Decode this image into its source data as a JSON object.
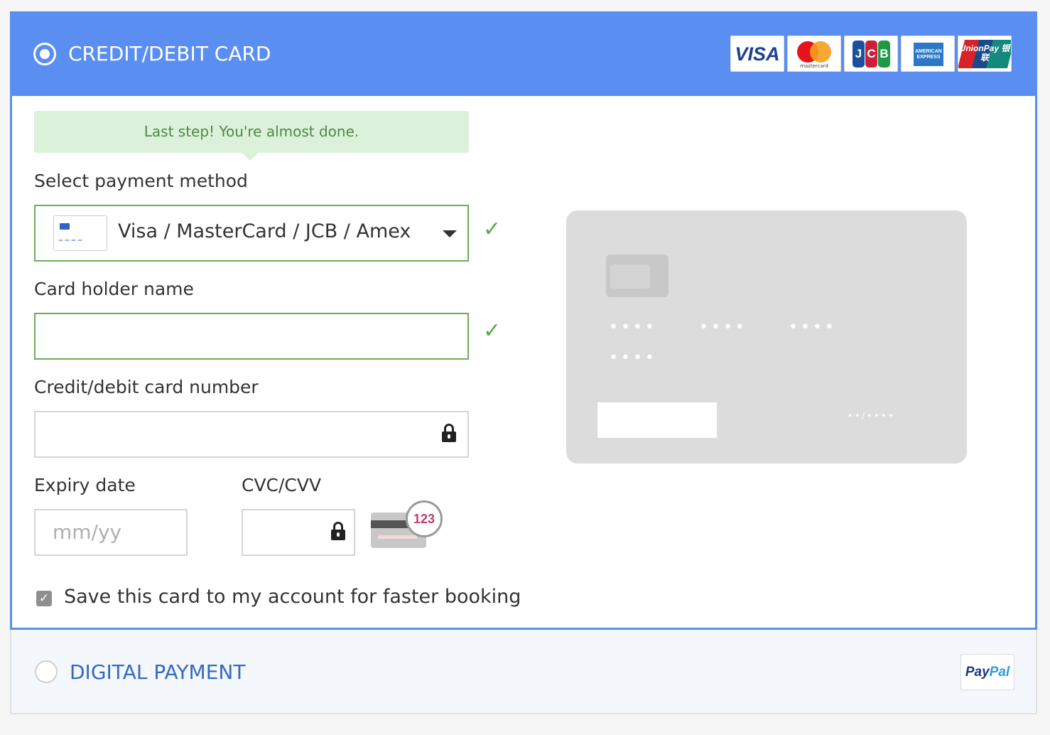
{
  "credit_section": {
    "title": "CREDIT/DEBIT CARD",
    "brands": [
      "VISA",
      "mastercard",
      "JCB",
      "AMERICAN EXPRESS",
      "UnionPay 银联"
    ]
  },
  "notice": "Last step! You're almost done.",
  "payment_method": {
    "label": "Select payment method",
    "selected": "Visa / MasterCard / JCB / Amex"
  },
  "card_holder": {
    "label": "Card holder name",
    "value": ""
  },
  "card_number": {
    "label": "Credit/debit card number",
    "value": ""
  },
  "expiry": {
    "label": "Expiry date",
    "placeholder": "mm/yy"
  },
  "cvc": {
    "label": "CVC/CVV",
    "hint_number": "123"
  },
  "card_preview": {
    "number_groups": [
      "••••",
      "••••",
      "••••",
      "••••"
    ],
    "expiry": "••/••••"
  },
  "save_card": {
    "checked": true,
    "label": "Save this card to my account for faster booking"
  },
  "digital_section": {
    "title": "DIGITAL PAYMENT",
    "brand_pay": "Pay",
    "brand_pal": "Pal"
  },
  "colors": {
    "accent": "#5a8ef0",
    "success": "#6aae56",
    "notice_bg": "#dcf1d9",
    "digital_title": "#3569c0"
  }
}
